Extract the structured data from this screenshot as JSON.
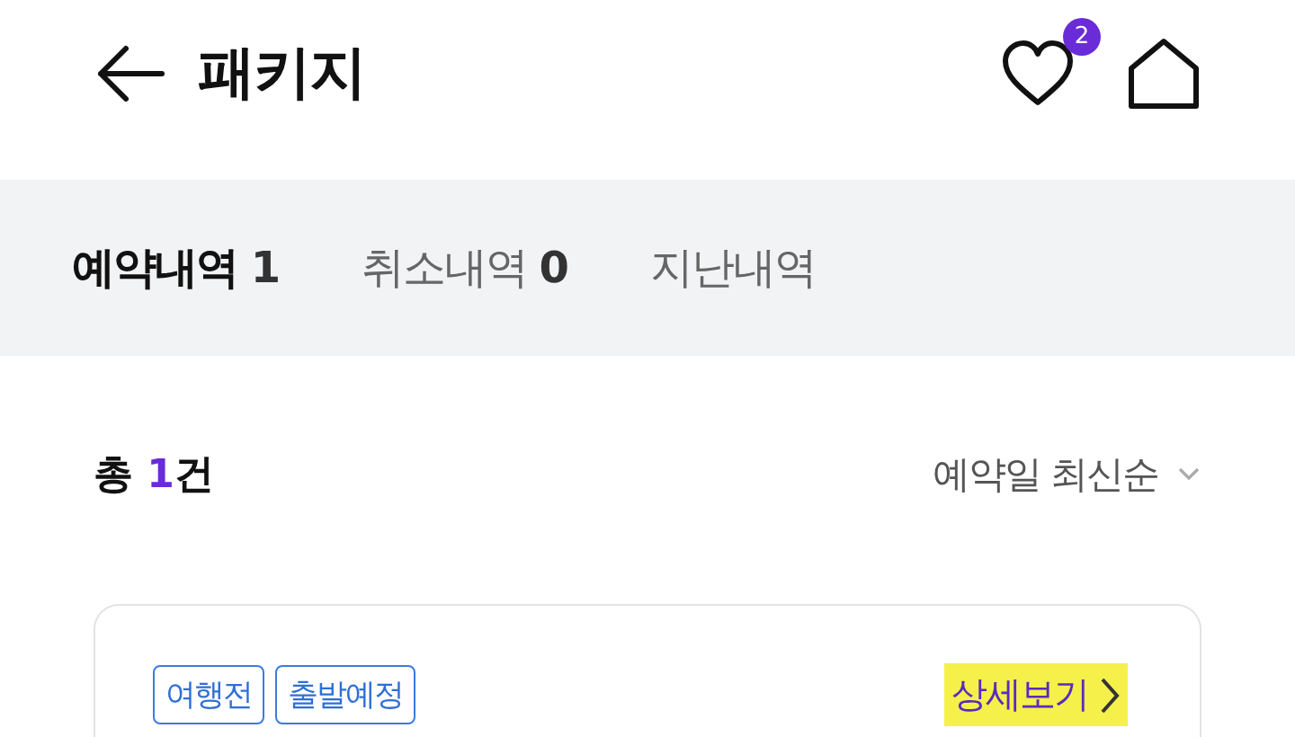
{
  "header": {
    "title": "패키지",
    "wishlist_badge": "2"
  },
  "tabs": [
    {
      "label": "예약내역",
      "count": "1",
      "selected": true
    },
    {
      "label": "취소내역",
      "count": "0",
      "selected": false
    },
    {
      "label": "지난내역",
      "selected": false
    }
  ],
  "summary": {
    "prefix": "총",
    "count": "1",
    "suffix": "건"
  },
  "sort": {
    "label": "예약일 최신순"
  },
  "bookings": [
    {
      "tags": [
        "여행전",
        "출발예정"
      ],
      "detail_link": "상세보기",
      "highlighted": true
    }
  ]
}
